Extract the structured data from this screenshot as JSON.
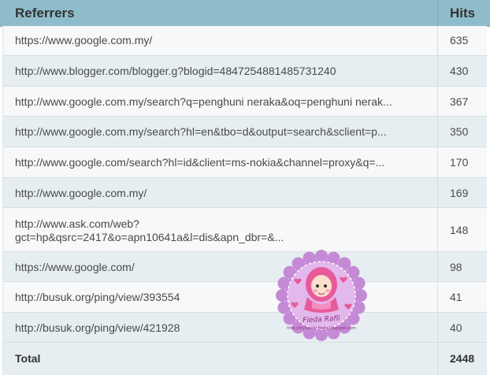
{
  "table": {
    "header_referrers": "Referrers",
    "header_hits": "Hits",
    "rows": [
      {
        "referrer": "https://www.google.com.my/",
        "hits": "635"
      },
      {
        "referrer": "http://www.blogger.com/blogger.g?blogid=4847254881485731240",
        "hits": "430"
      },
      {
        "referrer": "http://www.google.com.my/search?q=penghuni neraka&oq=penghuni nerak...",
        "hits": "367"
      },
      {
        "referrer": "http://www.google.com.my/search?hl=en&tbo=d&output=search&sclient=p...",
        "hits": "350"
      },
      {
        "referrer": "http://www.google.com/search?hl=id&client=ms-nokia&channel=proxy&q=...",
        "hits": "170"
      },
      {
        "referrer": "http://www.google.com.my/",
        "hits": "169"
      },
      {
        "referrer_line1": "http://www.ask.com/web?",
        "referrer_line2": "gct=hp&qsrc=2417&o=apn10641a&l=dis&apn_dbr=&...",
        "hits": "148"
      },
      {
        "referrer": "https://www.google.com/",
        "hits": "98"
      },
      {
        "referrer": "http://busuk.org/ping/view/393554",
        "hits": "41"
      },
      {
        "referrer": "http://busuk.org/ping/view/421928",
        "hits": "40"
      }
    ],
    "total_label": "Total",
    "total_hits": "2448"
  },
  "watermark": {
    "name": "Fieda Rafli",
    "url": "http://mylovely-fieda.blogspot.com",
    "colors": {
      "scallop": "#c58ad6",
      "inner": "#e3b8ec",
      "hijab": "#e85a9a",
      "face": "#fbe0cc"
    }
  }
}
